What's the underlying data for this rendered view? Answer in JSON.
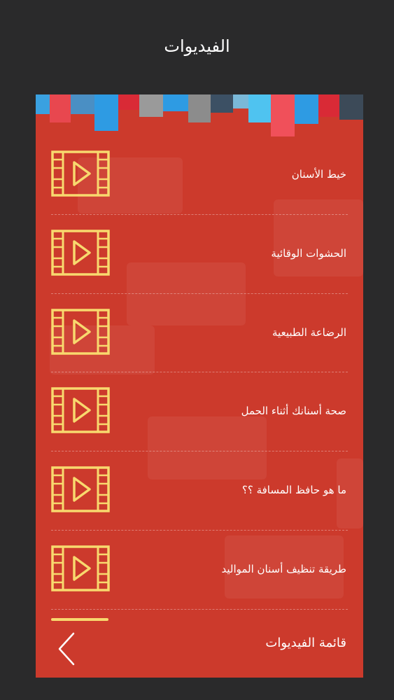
{
  "header": {
    "title": "الفيديوات"
  },
  "videos": [
    {
      "title": "خيط الأسنان",
      "icon": "video-play-icon"
    },
    {
      "title": "الحشوات الوقائية",
      "icon": "video-play-icon"
    },
    {
      "title": "الرضاعة الطبيعية",
      "icon": "video-play-icon"
    },
    {
      "title": "صحة أسنانك أثناء الحمل",
      "icon": "video-play-icon"
    },
    {
      "title": "ما هو حافظ المسافة ؟؟",
      "icon": "video-play-icon"
    },
    {
      "title": "طريقة تنظيف أسنان المواليد",
      "icon": "video-play-icon"
    }
  ],
  "footer": {
    "title": "قائمة الفيديوات",
    "back_icon": "chevron-left-icon"
  },
  "colors": {
    "panel": "#cc3a2c",
    "icon": "#f8d96e",
    "background": "#2a2a2b"
  }
}
